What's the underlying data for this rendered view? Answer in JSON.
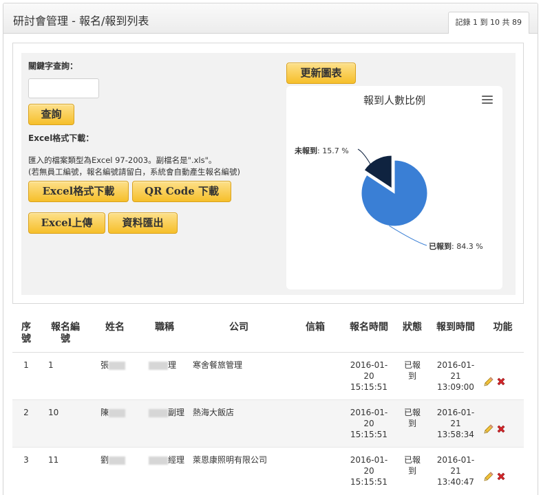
{
  "header": {
    "title": "研討會管理 - 報名/報到列表",
    "record_info": "記錄 1 到 10 共 89"
  },
  "search": {
    "keyword_label": "關鍵字查詢：",
    "keyword_value": "",
    "query_button": "查詢",
    "excel_label": "Excel格式下載：",
    "note_line1": "匯入的檔案類型為Excel 97-2003。副檔名是\".xls\"。",
    "note_line2": "(若無員工編號，報名編號請留白，系統會自動產生報名編號)",
    "excel_download_button": "Excel格式下載",
    "qr_download_button": "QR Code 下載",
    "excel_upload_button": "Excel上傳",
    "export_button": "資料匯出",
    "refresh_chart_button": "更新圖表"
  },
  "chart_data": {
    "type": "pie",
    "title": "報到人數比例",
    "slices": [
      {
        "name": "已報到",
        "value": 84.3,
        "color": "#3a7fd5"
      },
      {
        "name": "未報到",
        "value": 15.7,
        "color": "#0f2340"
      }
    ],
    "labels": {
      "checked": {
        "name": "已報到",
        "value": ": 84.3 %"
      },
      "unchecked": {
        "name": "未報到",
        "value": ": 15.7 %"
      }
    }
  },
  "table": {
    "headers": {
      "seq": "序號",
      "reg_no": "報名編號",
      "name": "姓名",
      "title": "職稱",
      "company": "公司",
      "email": "信箱",
      "reg_time": "報名時間",
      "status": "狀態",
      "checkin_time": "報到時間",
      "actions": "功能"
    },
    "rows": [
      {
        "seq": "1",
        "reg_no": "1",
        "name": "張",
        "title": "理",
        "company": "寒舍餐旅管理",
        "email": "",
        "reg_time": "2016-01-20 15:15:51",
        "status": "已報到",
        "checkin_time": "2016-01-21 13:09:00"
      },
      {
        "seq": "2",
        "reg_no": "10",
        "name": "陳",
        "title": "副理",
        "company": "熱海大飯店",
        "email": "",
        "reg_time": "2016-01-20 15:15:51",
        "status": "已報到",
        "checkin_time": "2016-01-21 13:58:34"
      },
      {
        "seq": "3",
        "reg_no": "11",
        "name": "劉",
        "title": "經理",
        "company": "萊恩康照明有限公司",
        "email": "",
        "reg_time": "2016-01-20 15:15:51",
        "status": "已報到",
        "checkin_time": "2016-01-21 13:40:47"
      }
    ]
  },
  "icons": {
    "edit": "pencil-icon",
    "delete": "cross-icon",
    "menu": "hamburger-menu-icon"
  }
}
